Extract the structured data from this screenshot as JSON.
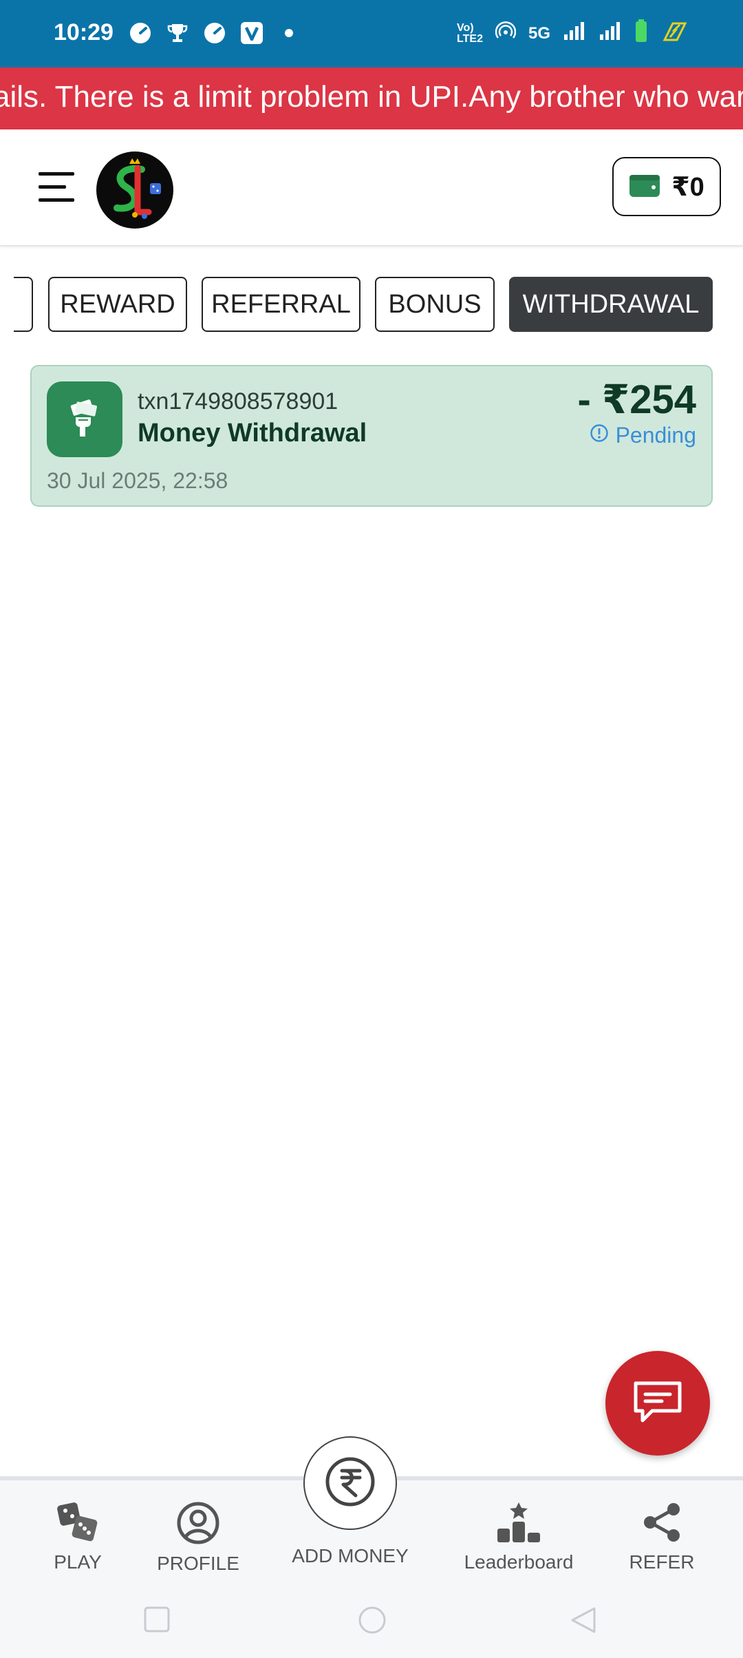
{
  "status_bar": {
    "time": "10:29",
    "network_label": "5G"
  },
  "marquee": {
    "text": "ails. There is a limit problem in UPI.Any brother who war"
  },
  "header": {
    "wallet_amount": "₹0"
  },
  "tabs": [
    {
      "label": "REWARD",
      "active": false
    },
    {
      "label": "REFERRAL",
      "active": false
    },
    {
      "label": "BONUS",
      "active": false
    },
    {
      "label": "WITHDRAWAL",
      "active": true
    }
  ],
  "transaction": {
    "id": "txn1749808578901",
    "title": "Money Withdrawal",
    "date": "30 Jul 2025, 22:58",
    "amount": "- ₹254",
    "status": "Pending"
  },
  "bottom_nav": {
    "play": "PLAY",
    "profile": "PROFILE",
    "add_money": "ADD MONEY",
    "leaderboard": "Leaderboard",
    "refer": "REFER"
  },
  "colors": {
    "status_bar": "#0a74a9",
    "marquee": "#dc3545",
    "active_tab": "#3a3d40",
    "card_bg": "#d0e8dc",
    "accent_green": "#2c8b56",
    "pending_blue": "#3a8fd6",
    "fab_red": "#c9252c"
  }
}
